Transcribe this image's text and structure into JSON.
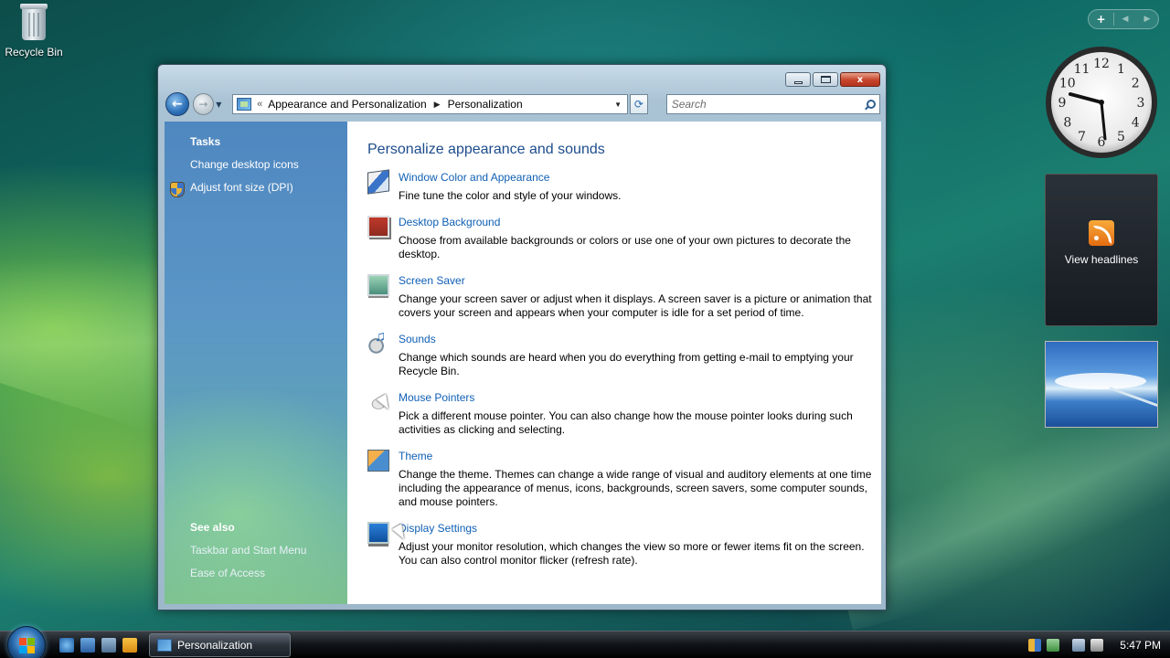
{
  "desktop": {
    "recycle_bin_label": "Recycle Bin"
  },
  "window": {
    "controls": {
      "minimize": "minimize",
      "maximize": "maximize",
      "close": "x"
    },
    "address": {
      "chevron": "«",
      "crumbs": [
        "Appearance and Personalization",
        "Personalization"
      ],
      "separator": "▶",
      "dropdown": "▼"
    },
    "search": {
      "placeholder": "Search"
    },
    "nav": {
      "back": "←",
      "forward": "→",
      "history": "▼",
      "refresh": "⟳"
    }
  },
  "left_pane": {
    "tasks_title": "Tasks",
    "tasks": [
      "Change desktop icons",
      "Adjust font size (DPI)"
    ],
    "see_also_title": "See also",
    "see_also": [
      "Taskbar and Start Menu",
      "Ease of Access"
    ]
  },
  "content": {
    "title": "Personalize appearance and sounds",
    "items": [
      {
        "title": "Window Color and Appearance",
        "desc": "Fine tune the color and style of your windows.",
        "icon": "window-color-icon"
      },
      {
        "title": "Desktop Background",
        "desc": "Choose from available backgrounds or colors or use one of your own pictures to decorate the desktop.",
        "icon": "desktop-background-icon"
      },
      {
        "title": "Screen Saver",
        "desc": "Change your screen saver or adjust when it displays. A screen saver is a picture or animation that covers your screen and appears when your computer is idle for a set period of time.",
        "icon": "screen-saver-icon"
      },
      {
        "title": "Sounds",
        "desc": "Change which sounds are heard when you do everything from getting e-mail to emptying your Recycle Bin.",
        "icon": "sounds-icon"
      },
      {
        "title": "Mouse Pointers",
        "desc": "Pick a different mouse pointer. You can also change how the mouse pointer looks during such activities as clicking and selecting.",
        "icon": "mouse-pointers-icon"
      },
      {
        "title": "Theme",
        "desc": "Change the theme. Themes can change a wide range of visual and auditory elements at one time including the appearance of menus, icons, backgrounds, screen savers, some computer sounds, and mouse pointers.",
        "icon": "theme-icon"
      },
      {
        "title": "Display Settings",
        "desc": "Adjust your monitor resolution, which changes the view so more or fewer items fit on the screen. You can also control monitor flicker (refresh rate).",
        "icon": "display-settings-icon"
      }
    ]
  },
  "sidebar": {
    "bar_plus": "+",
    "bar_prev": "◀",
    "bar_next": "▶",
    "clock_numbers": [
      "12",
      "1",
      "2",
      "3",
      "4",
      "5",
      "6",
      "7",
      "8",
      "9",
      "10",
      "11"
    ],
    "headlines_label": "View headlines"
  },
  "taskbar": {
    "task_label": "Personalization",
    "time": "5:47 PM"
  },
  "colors": {
    "link": "#0f5fb5",
    "title": "#1d4c8c",
    "left_pane_top": "#4f87c0",
    "left_pane_bottom": "#7bbf8e"
  }
}
